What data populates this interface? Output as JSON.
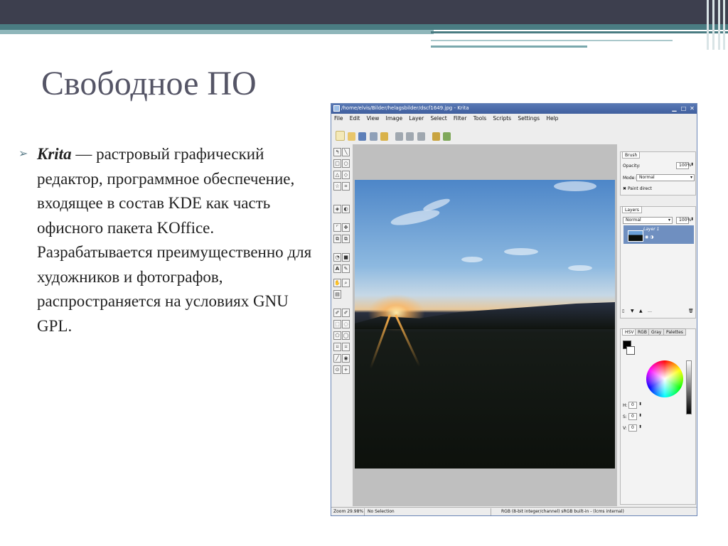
{
  "slide": {
    "title": "Свободное ПО",
    "bullet_term": "Krita",
    "bullet_text": " — растровый графический редактор, программное обеспечение, входящее в состав KDE как часть офисного пакета KOffice. Разрабатывается преимущественно для художников и фотографов, распространяется на условиях GNU GPL."
  },
  "krita": {
    "window_title": "/home/elvis/Bilder/helagsbilder/dscf1649.jpg - Krita",
    "menu": [
      "File",
      "Edit",
      "View",
      "Image",
      "Layer",
      "Select",
      "Filter",
      "Tools",
      "Scripts",
      "Settings",
      "Help"
    ],
    "brush_panel": {
      "tab": "Brush",
      "opacity_label": "Opacity:",
      "opacity_value": "100%",
      "mode_label": "Mode:",
      "mode_value": "Normal",
      "paint_direct": "Paint direct"
    },
    "layers_panel": {
      "tab": "Layers",
      "mode_value": "Normal",
      "opacity_value": "100%",
      "layer_name": "Layer 1"
    },
    "color_panel": {
      "tabs": [
        "HSV",
        "RGB",
        "Gray",
        "Palettes"
      ],
      "h_label": "H:",
      "h_value": "0",
      "s_label": "S:",
      "s_value": "0",
      "v_label": "V:",
      "v_value": "0"
    },
    "status": {
      "zoom": "Zoom 29.98%",
      "selection": "No Selection",
      "color_profile": "RGB (8-bit integer/channel)  sRGB built-in - (lcms internal)"
    }
  }
}
